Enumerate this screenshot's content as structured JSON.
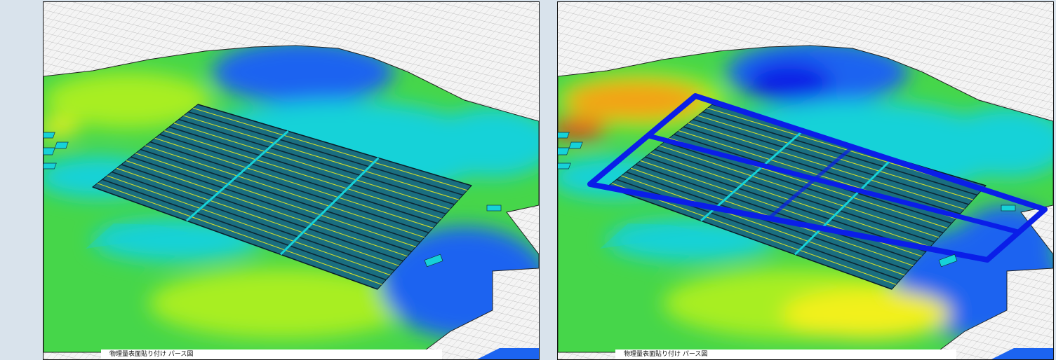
{
  "panels": [
    {
      "caption": "物理量表面貼り付け パース図",
      "layout_variant": "without-barrier"
    },
    {
      "caption": "物理量表面貼り付け パース図",
      "layout_variant": "with-barrier"
    }
  ],
  "colors": {
    "page_background": "#d9e3ec",
    "mesh_background": "#f4f4f4",
    "mesh_line": "#9a9a9a",
    "field_green": "#46d64a",
    "field_lime": "#a8ee22",
    "field_cyan": "#16d2d8",
    "field_blue": "#1c64f0",
    "field_deep_blue": "#0a22e6",
    "field_yellow": "#f2f01c",
    "field_orange": "#f3a214",
    "field_red": "#ee3212",
    "barrier_blue": "#0a1ee8",
    "panel_outline": "#111111"
  }
}
